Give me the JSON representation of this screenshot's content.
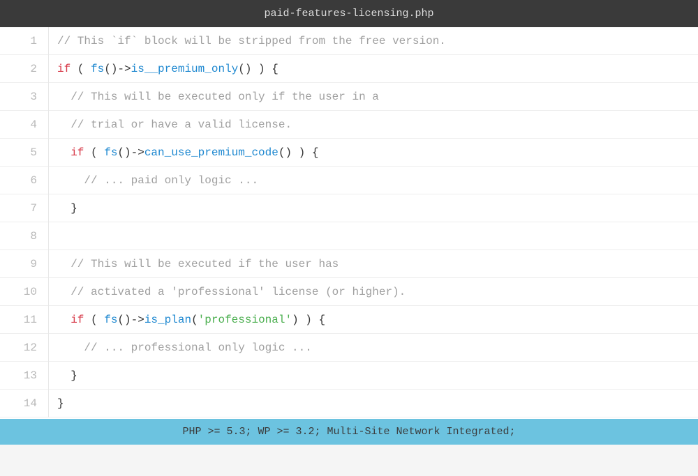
{
  "header": {
    "filename": "paid-features-licensing.php"
  },
  "code": {
    "line1": {
      "n": "1",
      "c1": "// This `if` block will be stripped from the free version."
    },
    "line2": {
      "n": "2",
      "kw": "if",
      "op1": " ( ",
      "fn": "fs",
      "pc": "()->",
      "me": "is__premium_only",
      "pc2": "() ) {"
    },
    "line3": {
      "n": "3",
      "c1": "// This will be executed only if the user in a"
    },
    "line4": {
      "n": "4",
      "c1": "// trial or have a valid license."
    },
    "line5": {
      "n": "5",
      "kw": "if",
      "op1": " ( ",
      "fn": "fs",
      "pc": "()->",
      "me": "can_use_premium_code",
      "pc2": "() ) {"
    },
    "line6": {
      "n": "6",
      "c1": "// ... paid only logic ..."
    },
    "line7": {
      "n": "7",
      "p": "}"
    },
    "line8": {
      "n": "8",
      "p": ""
    },
    "line9": {
      "n": "9",
      "c1": "// This will be executed if the user has"
    },
    "line10": {
      "n": "10",
      "c1": "// activated a 'professional' license (or higher)."
    },
    "line11": {
      "n": "11",
      "kw": "if",
      "op1": " ( ",
      "fn": "fs",
      "pc": "()->",
      "me": "is_plan",
      "pc2": "(",
      "str": "'professional'",
      "pc3": ") ) {"
    },
    "line12": {
      "n": "12",
      "c1": "// ... professional only logic ..."
    },
    "line13": {
      "n": "13",
      "p": "}"
    },
    "line14": {
      "n": "14",
      "p": "}"
    }
  },
  "status": {
    "text": "PHP >= 5.3; WP >= 3.2; Multi-Site Network Integrated;"
  }
}
